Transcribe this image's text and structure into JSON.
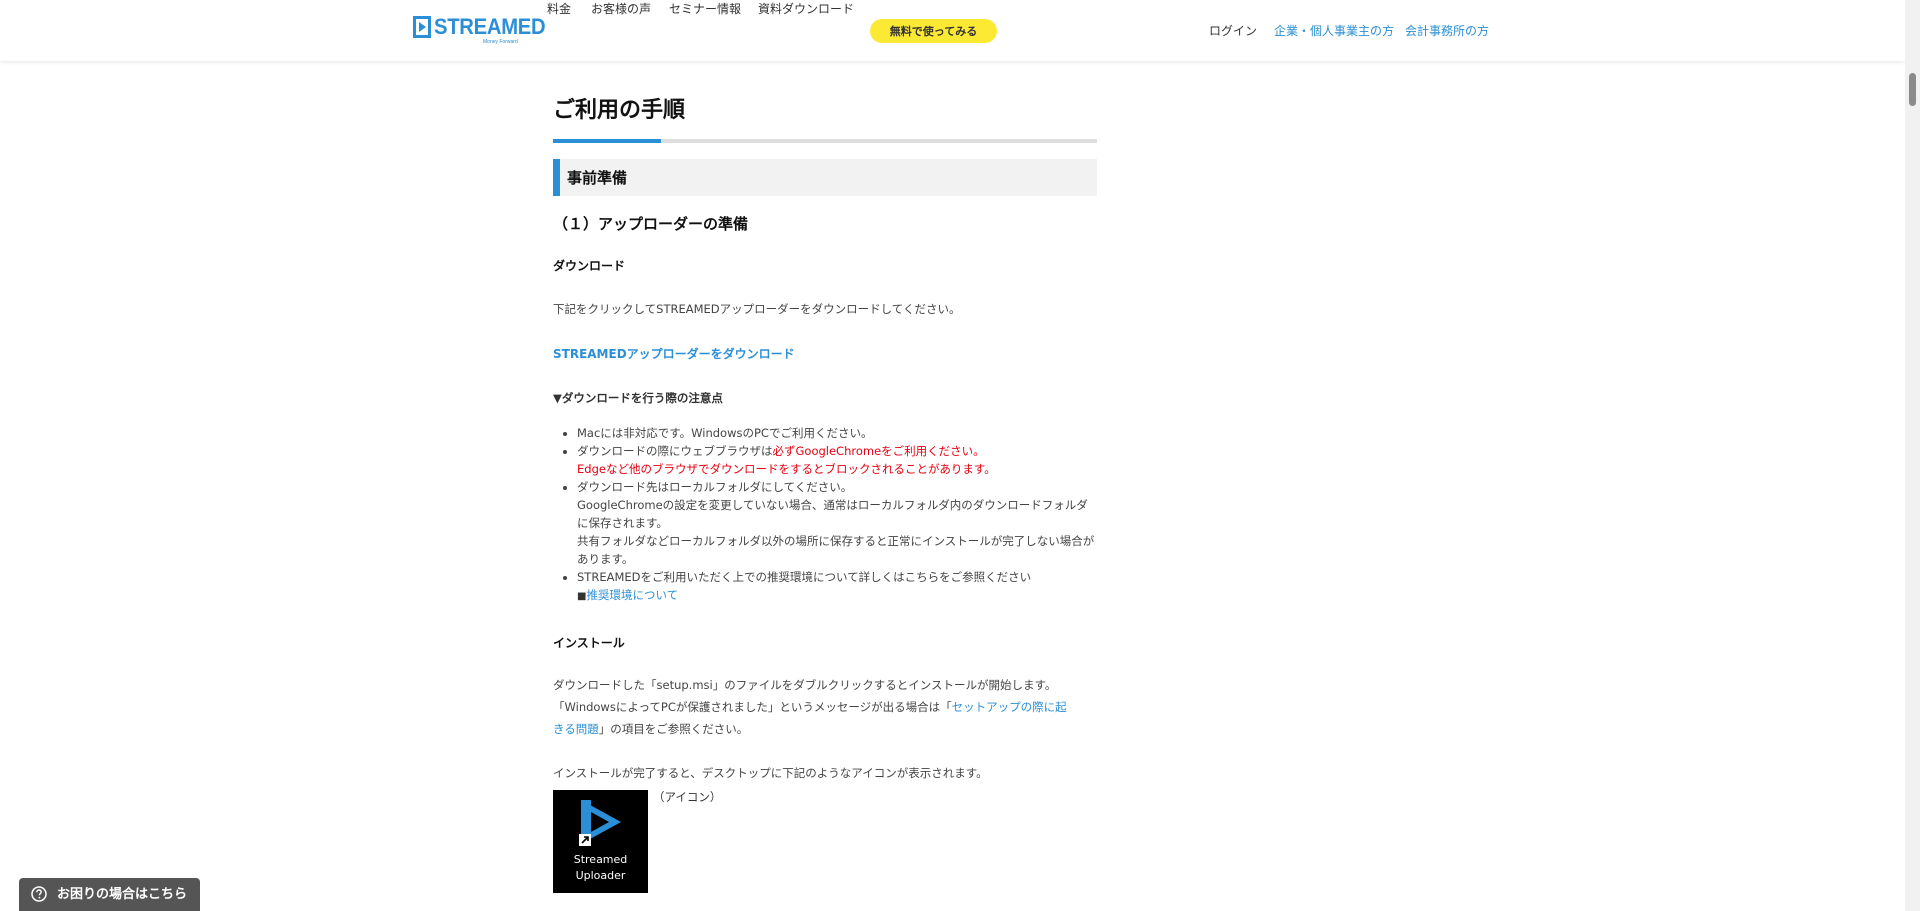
{
  "header": {
    "logo_text": "STREAMED",
    "logo_sub": "Money Forward",
    "nav": [
      "料金",
      "お客様の声",
      "セミナー情報",
      "資料ダウンロード"
    ],
    "cta": "無料で使ってみる",
    "login": "ログイン",
    "business": "企業・個人事業主の方",
    "accounting": "会計事務所の方"
  },
  "content": {
    "title": "ご利用の手順",
    "section": "事前準備",
    "subhead": "（１）アップローダーの準備",
    "download_head": "ダウンロード",
    "download_text": "下記をクリックしてSTREAMEDアップローダーをダウンロードしてください。",
    "download_link": "STREAMEDアップローダーをダウンロード",
    "notice_head": "▼ダウンロードを行う際の注意点",
    "notes": {
      "n1": "Macには非対応です。WindowsのPCでご利用ください。",
      "n2a": "ダウンロードの際にウェブブラウザは",
      "n2b": "必ずGoogleChromeをご利用ください。",
      "n2c": "Edgeなど他のブラウザでダウンロードをするとブロックされることがあります。",
      "n3a": "ダウンロード先はローカルフォルダにしてください。",
      "n3b": "GoogleChromeの設定を変更していない場合、通常はローカルフォルダ内のダウンロードフォルダに保存されます。",
      "n3c": "共有フォルダなどローカルフォルダ以外の場所に保存すると正常にインストールが完了しない場合があります。",
      "n4a": "STREAMEDをご利用いただく上での推奨環境について詳しくはこちらをご参照ください",
      "n4_square": "■",
      "n4_link": "推奨環境について"
    },
    "install_head": "インストール",
    "install_text1": "ダウンロードした「setup.msi」のファイルをダブルクリックするとインストールが開始します。",
    "install_text2a": "「WindowsによってPCが保護されました」というメッセージが出る場合は「",
    "install_text2_link1": "セットアップの際に起",
    "install_text2_link2": "きる問題",
    "install_text2b": "」の項目をご参照ください。",
    "install_done": "インストールが完了すると、デスクトップに下記のようなアイコンが表示されます。",
    "icon_label_1": "Streamed",
    "icon_label_2": "Uploader",
    "icon_caption": "（アイコン）"
  },
  "help": {
    "label": "お困りの場合はこちら"
  },
  "colors": {
    "accent": "#2a8fd6",
    "cta": "#fce934",
    "warning": "#e60012"
  }
}
